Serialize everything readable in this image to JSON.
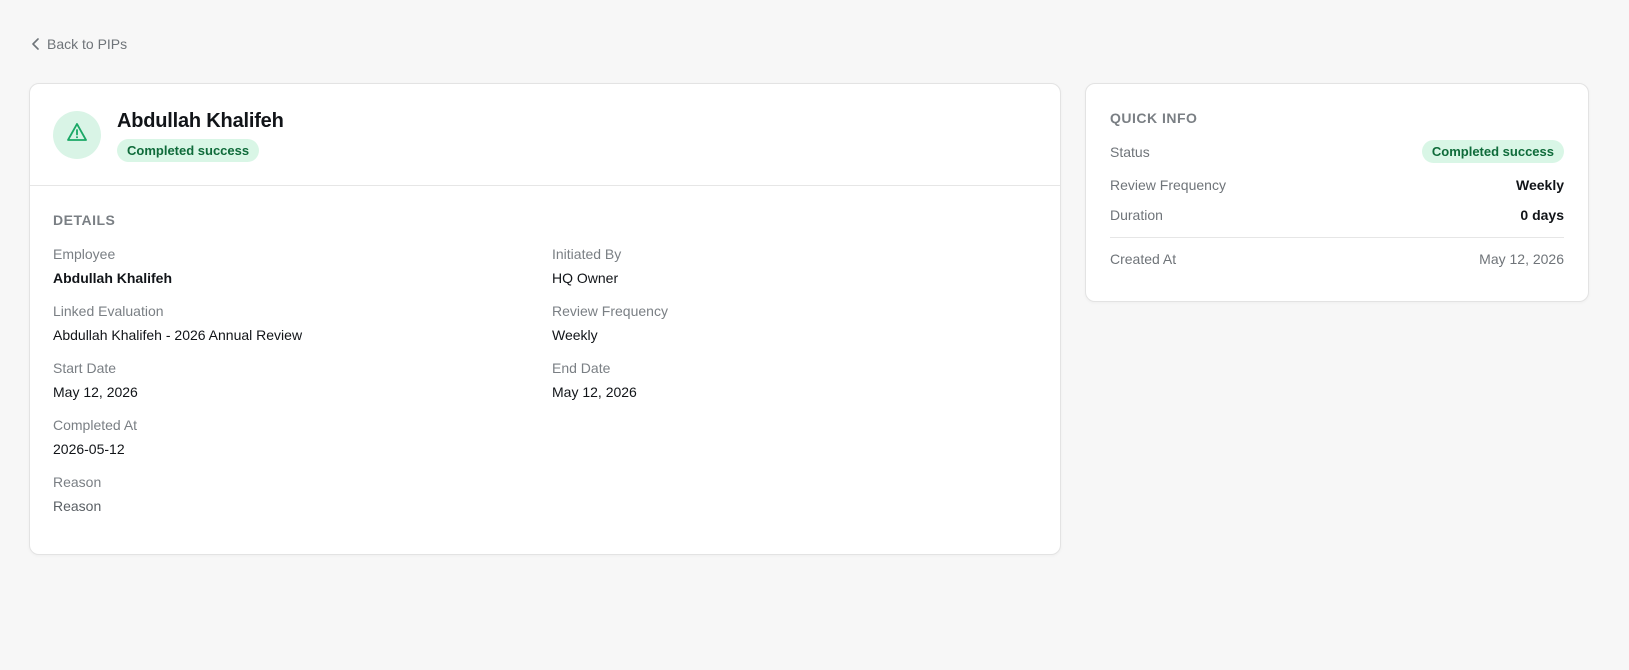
{
  "nav": {
    "back_label": "Back to PIPs"
  },
  "header": {
    "name": "Abdullah Khalifeh",
    "status_badge": "Completed success"
  },
  "details": {
    "section_title": "DETAILS",
    "fields": {
      "employee": {
        "label": "Employee",
        "value": "Abdullah Khalifeh"
      },
      "initiated_by": {
        "label": "Initiated By",
        "value": "HQ Owner"
      },
      "linked_evaluation": {
        "label": "Linked Evaluation",
        "value": "Abdullah Khalifeh - 2026 Annual Review"
      },
      "review_frequency": {
        "label": "Review Frequency",
        "value": "Weekly"
      },
      "start_date": {
        "label": "Start Date",
        "value": "May 12, 2026"
      },
      "end_date": {
        "label": "End Date",
        "value": "May 12, 2026"
      },
      "completed_at": {
        "label": "Completed At",
        "value": "2026-05-12"
      },
      "reason": {
        "label": "Reason",
        "value": "Reason"
      }
    }
  },
  "quick_info": {
    "title": "QUICK INFO",
    "status": {
      "label": "Status",
      "value": "Completed success"
    },
    "review_frequency": {
      "label": "Review Frequency",
      "value": "Weekly"
    },
    "duration": {
      "label": "Duration",
      "value": "0 days"
    },
    "created_at": {
      "label": "Created At",
      "value": "May 12, 2026"
    }
  },
  "icons": {
    "avatar": "warning-triangle-icon",
    "back": "chevron-left-icon"
  },
  "colors": {
    "success_bg": "#d9f6e6",
    "success_text": "#0f6b3a",
    "icon_green": "#1aa866"
  }
}
